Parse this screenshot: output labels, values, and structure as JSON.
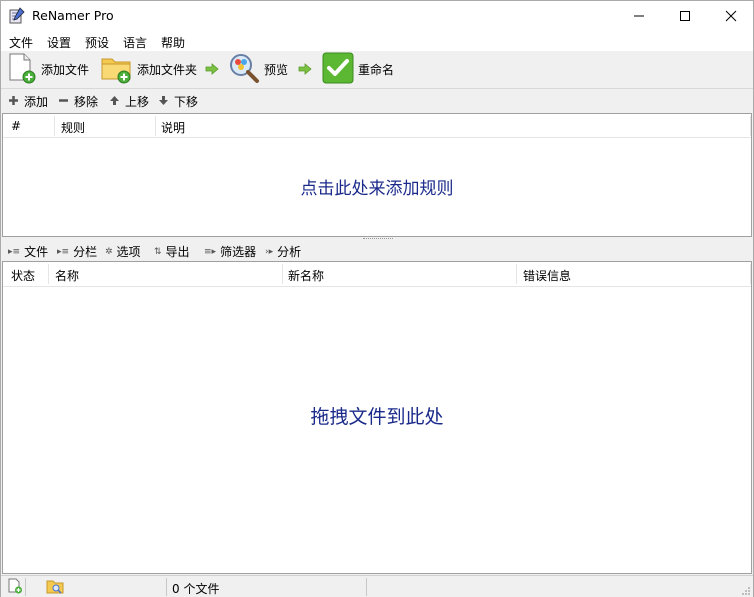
{
  "window": {
    "title": "ReNamer Pro"
  },
  "menu": {
    "items": [
      "文件",
      "设置",
      "预设",
      "语言",
      "帮助"
    ]
  },
  "toolbar": {
    "add_files": "添加文件",
    "add_folder": "添加文件夹",
    "preview": "预览",
    "rename": "重命名"
  },
  "rules_toolbar": {
    "add": "添加",
    "remove": "移除",
    "up": "上移",
    "down": "下移"
  },
  "rules_table": {
    "columns": [
      "#",
      "规则",
      "说明"
    ],
    "empty_hint": "点击此处来添加规则"
  },
  "files_toolbar": {
    "files": "文件",
    "columns": "分栏",
    "options": "选项",
    "export": "导出",
    "filters": "筛选器",
    "analyze": "分析"
  },
  "files_table": {
    "columns": [
      "状态",
      "名称",
      "新名称",
      "错误信息"
    ],
    "empty_hint": "拖拽文件到此处"
  },
  "statusbar": {
    "file_count": "0 个文件"
  },
  "colors": {
    "hint_text": "#1a2a8a",
    "rename_green": "#5cb832",
    "arrow_green": "#7cc242"
  }
}
